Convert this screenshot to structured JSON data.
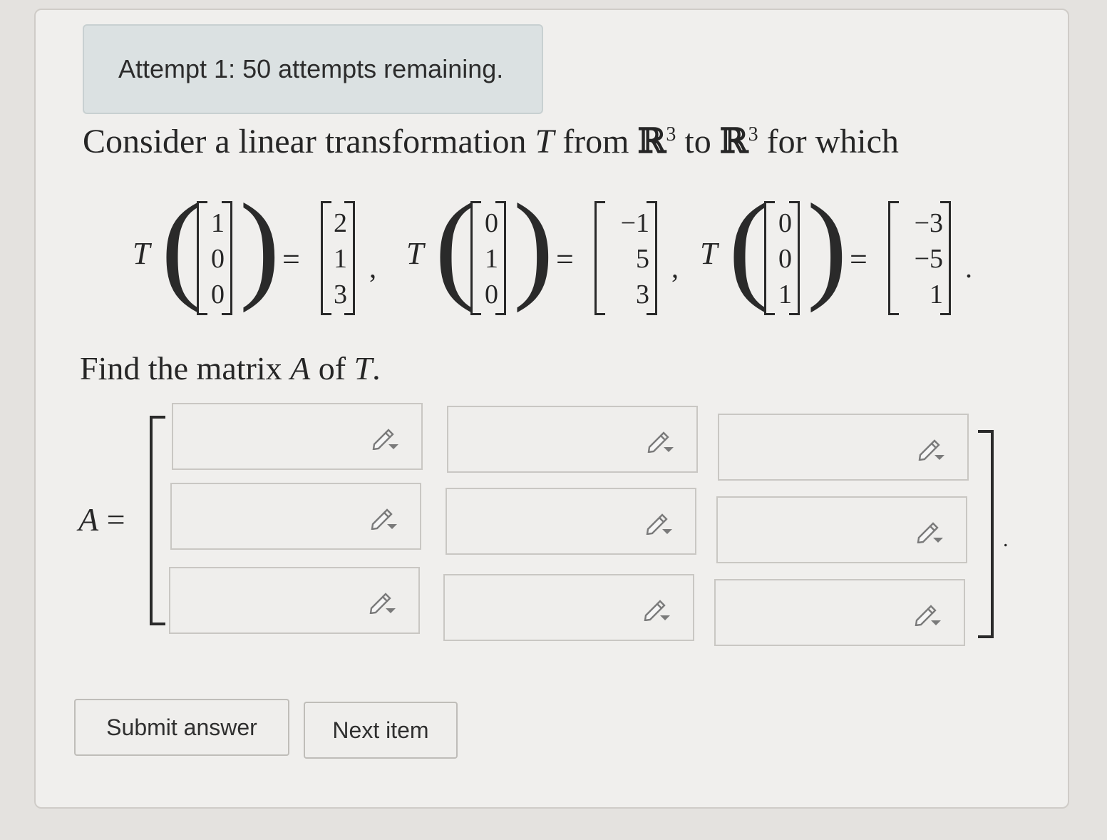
{
  "attempt": {
    "text": "Attempt 1: 50 attempts remaining."
  },
  "prompt": {
    "part1": "Consider a linear transformation ",
    "T": "T",
    "part2": " from ",
    "R": "ℝ",
    "exp": "3",
    "part3": " to ",
    "part4": " for which"
  },
  "equations": [
    {
      "label": "T",
      "input": [
        "1",
        "0",
        "0"
      ],
      "output": [
        "2",
        "1",
        "3"
      ],
      "sep": ","
    },
    {
      "label": "T",
      "input": [
        "0",
        "1",
        "0"
      ],
      "output": [
        "−1",
        "5",
        "3"
      ],
      "sep": ","
    },
    {
      "label": "T",
      "input": [
        "0",
        "0",
        "1"
      ],
      "output": [
        "−3",
        "−5",
        "1"
      ],
      "sep": "."
    }
  ],
  "equals": "=",
  "find": {
    "part1": "Find the matrix ",
    "A": "A",
    "part2": " of ",
    "T": "T",
    "end": "."
  },
  "matrix_label": {
    "A": "A",
    "eq": " ="
  },
  "answer_cells": [
    [
      "",
      "",
      ""
    ],
    [
      "",
      "",
      ""
    ],
    [
      "",
      "",
      ""
    ]
  ],
  "end_dot": ".",
  "buttons": {
    "submit": "Submit answer",
    "next": "Next item"
  },
  "icons": {
    "cell_icon": "pencil-dropdown-icon"
  }
}
